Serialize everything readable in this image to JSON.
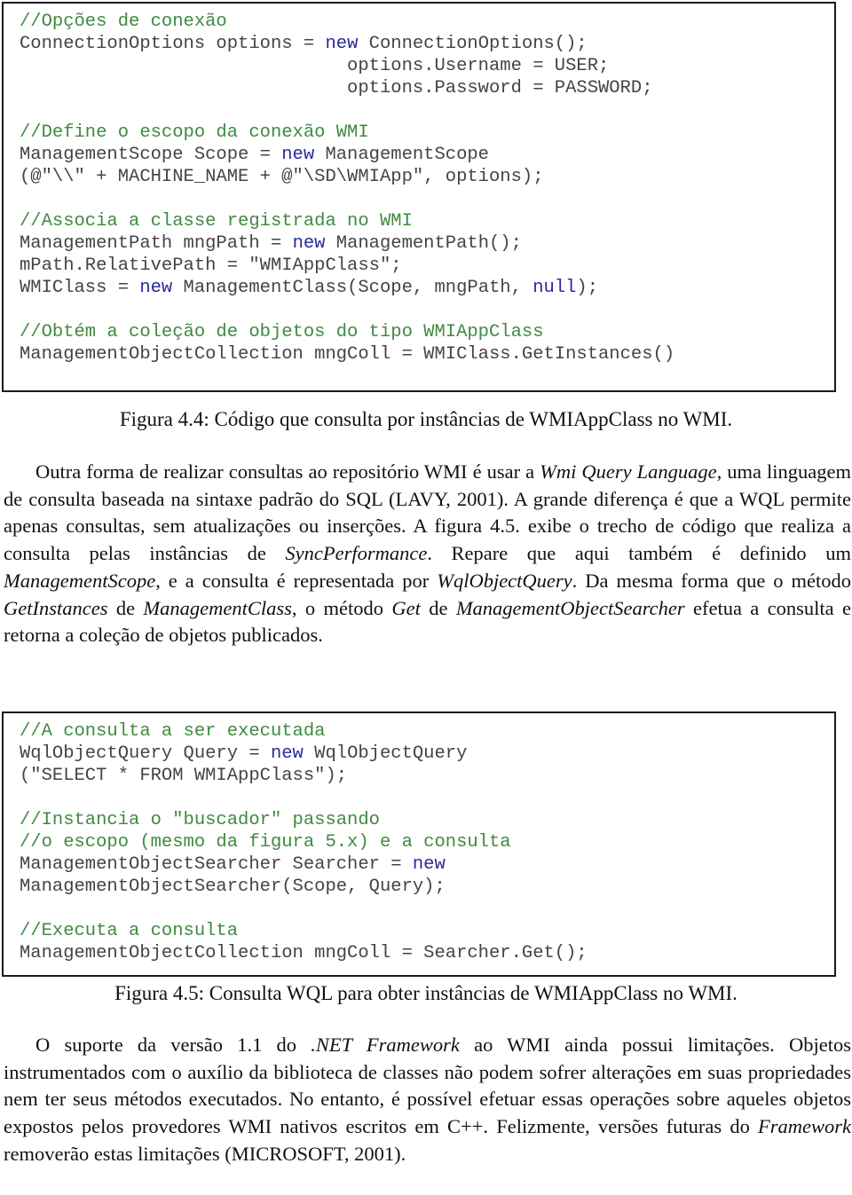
{
  "figure_4_4": {
    "code_lines": [
      [
        {
          "t": "//Opções de conexão",
          "c": "cm"
        }
      ],
      [
        {
          "t": "ConnectionOptions options = ",
          "c": ""
        },
        {
          "t": "new",
          "c": "kw"
        },
        {
          "t": " ConnectionOptions();",
          "c": ""
        }
      ],
      [
        {
          "t": "                              options.Username = USER;",
          "c": ""
        }
      ],
      [
        {
          "t": "                              options.Password = PASSWORD;",
          "c": ""
        }
      ],
      [],
      [
        {
          "t": "//Define o escopo da conexão WMI",
          "c": "cm"
        }
      ],
      [
        {
          "t": "ManagementScope Scope = ",
          "c": ""
        },
        {
          "t": "new",
          "c": "kw"
        },
        {
          "t": " ManagementScope",
          "c": ""
        }
      ],
      [
        {
          "t": "(@\"\\\\\" + MACHINE_NAME + @\"\\SD\\WMIApp\", options);",
          "c": ""
        }
      ],
      [],
      [
        {
          "t": "//Associa a classe registrada no WMI",
          "c": "cm"
        }
      ],
      [
        {
          "t": "ManagementPath mngPath = ",
          "c": ""
        },
        {
          "t": "new",
          "c": "kw"
        },
        {
          "t": " ManagementPath();",
          "c": ""
        }
      ],
      [
        {
          "t": "mPath.RelativePath = \"WMIAppClass\";",
          "c": ""
        }
      ],
      [
        {
          "t": "WMIClass = ",
          "c": ""
        },
        {
          "t": "new",
          "c": "kw"
        },
        {
          "t": " ManagementClass(Scope, mngPath, ",
          "c": ""
        },
        {
          "t": "null",
          "c": "kw"
        },
        {
          "t": ");",
          "c": ""
        }
      ],
      [],
      [
        {
          "t": "//Obtém a coleção de objetos do tipo WMIAppClass",
          "c": "cm"
        }
      ],
      [
        {
          "t": "ManagementObjectCollection mngColl = WMIClass.GetInstances()",
          "c": ""
        }
      ]
    ],
    "caption": "Figura 4.4: Código que consulta por instâncias de WMIAppClass no WMI."
  },
  "paragraph_1": [
    {
      "t": "Outra forma de realizar consultas ao repositório WMI é usar a ",
      "i": false
    },
    {
      "t": "Wmi Query Language",
      "i": true
    },
    {
      "t": ", uma linguagem de consulta baseada na sintaxe padrão do SQL (LAVY, 2001). A grande diferença é que a WQL permite apenas consultas, sem atualizações ou inserções. A figura 4.5. exibe o trecho de código que realiza a consulta pelas instâncias de ",
      "i": false
    },
    {
      "t": "SyncPerformance",
      "i": true
    },
    {
      "t": ". Repare que aqui também é definido um ",
      "i": false
    },
    {
      "t": "ManagementScope",
      "i": true
    },
    {
      "t": ", e a consulta é representada por ",
      "i": false
    },
    {
      "t": "WqlObjectQuery",
      "i": true
    },
    {
      "t": ". Da mesma forma que o método ",
      "i": false
    },
    {
      "t": "GetInstances",
      "i": true
    },
    {
      "t": " de ",
      "i": false
    },
    {
      "t": "ManagementClass",
      "i": true
    },
    {
      "t": ", o método ",
      "i": false
    },
    {
      "t": "Get",
      "i": true
    },
    {
      "t": " de ",
      "i": false
    },
    {
      "t": "ManagementObjectSearcher",
      "i": true
    },
    {
      "t": " efetua a consulta e retorna a coleção de objetos publicados.",
      "i": false
    }
  ],
  "figure_4_5": {
    "code_lines": [
      [
        {
          "t": "//A consulta a ser executada",
          "c": "cm"
        }
      ],
      [
        {
          "t": "WqlObjectQuery Query = ",
          "c": ""
        },
        {
          "t": "new",
          "c": "kw"
        },
        {
          "t": " WqlObjectQuery",
          "c": ""
        }
      ],
      [
        {
          "t": "(\"SELECT * FROM WMIAppClass\");",
          "c": ""
        }
      ],
      [],
      [
        {
          "t": "//Instancia o \"buscador\" passando",
          "c": "cm"
        }
      ],
      [
        {
          "t": "//o escopo (mesmo da figura 5.x) e a consulta",
          "c": "cm"
        }
      ],
      [
        {
          "t": "ManagementObjectSearcher Searcher = ",
          "c": ""
        },
        {
          "t": "new",
          "c": "kw"
        }
      ],
      [
        {
          "t": "ManagementObjectSearcher(Scope, Query);",
          "c": ""
        }
      ],
      [],
      [
        {
          "t": "//Executa a consulta",
          "c": "cm"
        }
      ],
      [
        {
          "t": "ManagementObjectCollection mngColl = Searcher.Get();",
          "c": ""
        }
      ]
    ],
    "caption": "Figura 4.5: Consulta WQL para obter instâncias de WMIAppClass no WMI."
  },
  "paragraph_2": [
    {
      "t": "O suporte da versão 1.1 do ",
      "i": false
    },
    {
      "t": ".NET Framework",
      "i": true
    },
    {
      "t": " ao WMI ainda possui limitações. Objetos instrumentados com o auxílio da biblioteca de classes não podem sofrer alterações em suas propriedades nem ter seus métodos executados. No entanto, é possível efetuar essas operações sobre aqueles objetos expostos pelos provedores WMI nativos escritos em C++. Felizmente, versões futuras do ",
      "i": false
    },
    {
      "t": "Framework",
      "i": true
    },
    {
      "t": " removerão estas limitações (MICROSOFT, 2001).",
      "i": false
    }
  ],
  "colors": {
    "comment": "#3f8a3f",
    "keyword": "#2a2a9a",
    "code_text": "#444444",
    "body_text": "#111111"
  }
}
